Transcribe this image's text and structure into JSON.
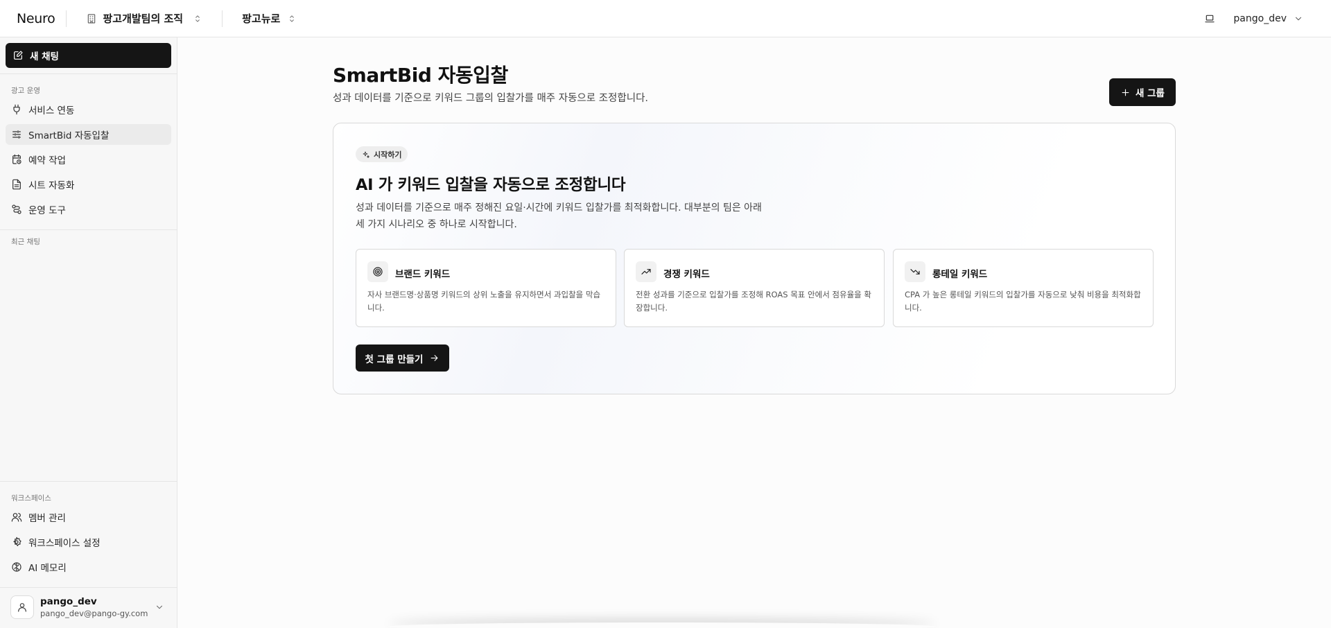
{
  "topbar": {
    "brand": "Neuro",
    "org_name": "팡고개발팀의 조직",
    "project_name": "팡고뉴로",
    "username": "pango_dev"
  },
  "sidebar": {
    "new_chat_label": "새 채팅",
    "sections": {
      "ads_ops": "광고 운영",
      "recent_chats": "최근 채팅",
      "workspace": "워크스페이스"
    },
    "ads_items": [
      {
        "label": "서비스 연동",
        "icon": "plug-icon"
      },
      {
        "label": "SmartBid 자동입찰",
        "icon": "sliders-icon",
        "active": true
      },
      {
        "label": "예약 작업",
        "icon": "calendar-clock-icon"
      },
      {
        "label": "시트 자동화",
        "icon": "sheet-icon"
      },
      {
        "label": "운영 도구",
        "icon": "route-icon"
      }
    ],
    "workspace_items": [
      {
        "label": "멤버 관리",
        "icon": "users-icon"
      },
      {
        "label": "워크스페이스 설정",
        "icon": "gear-icon"
      },
      {
        "label": "AI 메모리",
        "icon": "brain-icon"
      }
    ],
    "user": {
      "name": "pango_dev",
      "email": "pango_dev@pango-gy.com"
    }
  },
  "main": {
    "title": "SmartBid 자동입찰",
    "subtitle": "성과 데이터를 기준으로 키워드 그룹의 입찰가를 매주 자동으로 조정합니다.",
    "new_group_label": "새 그룹",
    "intro": {
      "badge": "시작하기",
      "title": "AI 가 키워드 입찰을 자동으로 조정합니다",
      "description": "성과 데이터를 기준으로 매주 정해진 요일·시간에 키워드 입찰가를 최적화합니다. 대부분의 팀은 아래 세 가지 시나리오 중 하나로 시작합니다.",
      "scenarios": [
        {
          "title": "브랜드 키워드",
          "description": "자사 브랜드명·상품명 키워드의 상위 노출을 유지하면서 과입찰을 막습니다.",
          "icon": "target-icon"
        },
        {
          "title": "경쟁 키워드",
          "description": "전환 성과를 기준으로 입찰가를 조정해 ROAS 목표 안에서 점유율을 확장합니다.",
          "icon": "trending-up-icon"
        },
        {
          "title": "롱테일 키워드",
          "description": "CPA 가 높은 롱테일 키워드의 입찰가를 자동으로 낮춰 비용을 최적화합니다.",
          "icon": "trending-down-icon"
        }
      ],
      "cta_label": "첫 그룹 만들기"
    }
  },
  "colors": {
    "primary_button": "#151515",
    "sidebar_bg": "#f7f7f7",
    "active_item_bg": "#ebebeb"
  }
}
